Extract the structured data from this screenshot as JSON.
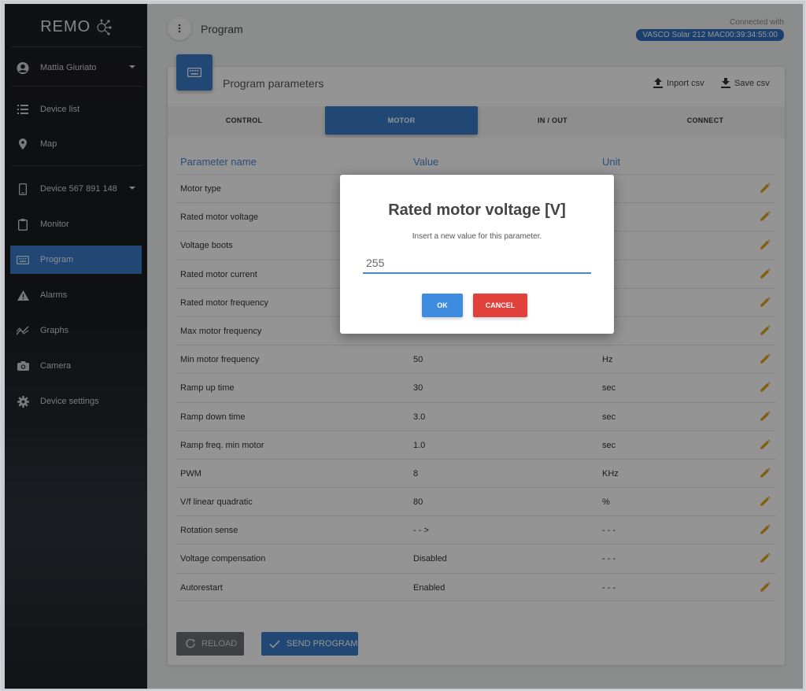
{
  "app": {
    "logo": "REMO"
  },
  "sidebar": {
    "user": "Mattia Giuriato",
    "nav": [
      {
        "label": "Device list",
        "icon": "list-icon"
      },
      {
        "label": "Map",
        "icon": "map-pin-icon"
      }
    ],
    "device": "Device 567 891 148",
    "items": [
      {
        "label": "Monitor",
        "icon": "clipboard-icon"
      },
      {
        "label": "Program",
        "icon": "keyboard-icon",
        "active": true
      },
      {
        "label": "Alarms",
        "icon": "warning-icon"
      },
      {
        "label": "Graphs",
        "icon": "graph-icon"
      },
      {
        "label": "Camera",
        "icon": "camera-icon"
      },
      {
        "label": "Device settings",
        "icon": "gear-icon"
      }
    ]
  },
  "header": {
    "title": "Program",
    "connected_label": "Connected with",
    "connected_device": "VASCO Solar 212  MAC00:39:34:55:00"
  },
  "card": {
    "title": "Program parameters",
    "import_label": "Inport csv",
    "save_label": "Save csv",
    "tabs": [
      "CONTROL",
      "MOTOR",
      "IN / OUT",
      "CONNECT"
    ],
    "active_tab": "MOTOR",
    "columns": {
      "name": "Parameter name",
      "value": "Value",
      "unit": "Unit"
    },
    "rows": [
      {
        "name": "Motor type",
        "value": "",
        "unit": ""
      },
      {
        "name": "Rated motor voltage",
        "value": "",
        "unit": ""
      },
      {
        "name": "Voltage boots",
        "value": "",
        "unit": ""
      },
      {
        "name": "Rated motor current",
        "value": "",
        "unit": ""
      },
      {
        "name": "Rated motor frequency",
        "value": "",
        "unit": ""
      },
      {
        "name": "Max motor frequency",
        "value": "",
        "unit": ""
      },
      {
        "name": "Min motor frequency",
        "value": "50",
        "unit": "Hz"
      },
      {
        "name": "Ramp up time",
        "value": "30",
        "unit": "sec"
      },
      {
        "name": "Ramp down time",
        "value": "3.0",
        "unit": "sec"
      },
      {
        "name": "Ramp freq. min motor",
        "value": "1.0",
        "unit": "sec"
      },
      {
        "name": "PWM",
        "value": "8",
        "unit": "KHz"
      },
      {
        "name": "V/f linear quadratic",
        "value": "80",
        "unit": "%"
      },
      {
        "name": "Rotation sense",
        "value": "- - >",
        "unit": "- - -"
      },
      {
        "name": "Voltage compensation",
        "value": "Disabled",
        "unit": "- - -"
      },
      {
        "name": "Autorestart",
        "value": "Enabled",
        "unit": "- - -"
      }
    ],
    "reload_label": "RELOAD",
    "send_label": "SEND PROGRAM"
  },
  "modal": {
    "title": "Rated motor voltage [V]",
    "subtitle": "Insert a new value for this parameter.",
    "input_value": "255",
    "ok_label": "OK",
    "cancel_label": "CANCEL"
  },
  "colors": {
    "accent": "#3a7bc8",
    "danger": "#e2403a",
    "edit_icon": "#e0a21e"
  }
}
